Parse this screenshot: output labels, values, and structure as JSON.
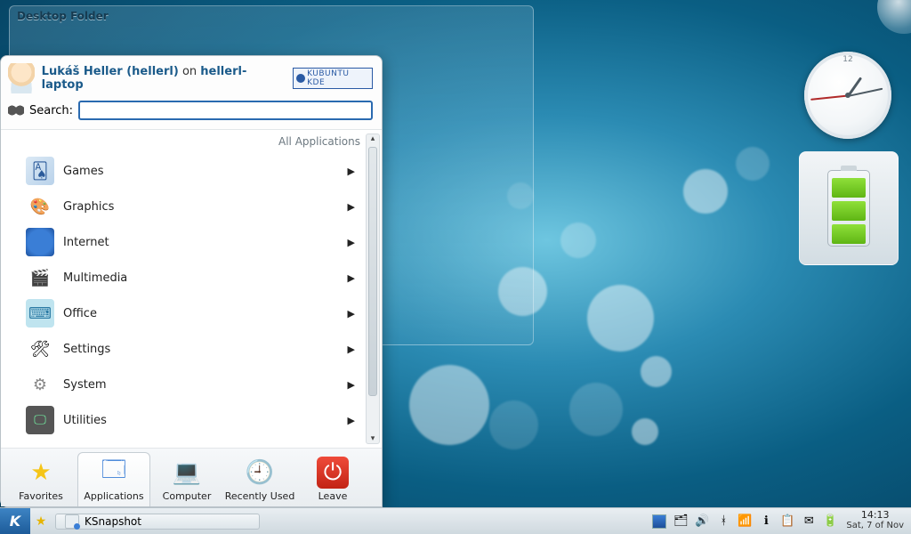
{
  "desktop_folder": {
    "title": "Desktop Folder"
  },
  "clock_widget": {
    "top_numeral": "12"
  },
  "kickoff": {
    "user_display": "Lukáš Heller (hellerl)",
    "on_word": "on",
    "hostname": "hellerl-laptop",
    "badge": "KUBUNTU KDE",
    "search_label": "Search:",
    "search_value": "",
    "breadcrumb": "All Applications",
    "categories": [
      {
        "label": "Games",
        "icon": "ic-games"
      },
      {
        "label": "Graphics",
        "icon": "ic-graphics"
      },
      {
        "label": "Internet",
        "icon": "ic-internet"
      },
      {
        "label": "Multimedia",
        "icon": "ic-mm"
      },
      {
        "label": "Office",
        "icon": "ic-office"
      },
      {
        "label": "Settings",
        "icon": "ic-settings"
      },
      {
        "label": "System",
        "icon": "ic-system"
      },
      {
        "label": "Utilities",
        "icon": "ic-util"
      }
    ],
    "tabs": [
      {
        "label": "Favorites",
        "icon": "ti-fav",
        "glyph": "★"
      },
      {
        "label": "Applications",
        "icon": "ti-app",
        "glyph": "🗔",
        "active": true
      },
      {
        "label": "Computer",
        "icon": "ti-comp",
        "glyph": "💻"
      },
      {
        "label": "Recently Used",
        "icon": "ti-recent",
        "glyph": "🕘"
      },
      {
        "label": "Leave",
        "icon": "ti-leave",
        "glyph": "⏻"
      }
    ]
  },
  "taskbar": {
    "task": "KSnapshot",
    "tray_icons": [
      "desktop-pager-icon",
      "folder-open-icon",
      "volume-icon",
      "bluetooth-icon",
      "network-icon",
      "info-icon",
      "clipboard-icon",
      "mail-icon",
      "battery-icon"
    ],
    "time": "14:13",
    "date": "Sat, 7 of Nov"
  }
}
